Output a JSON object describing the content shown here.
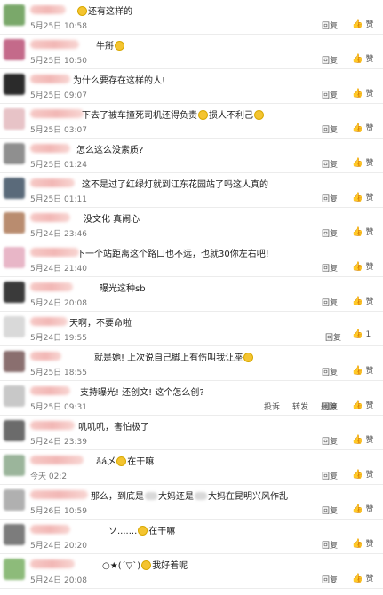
{
  "ui": {
    "reply_label": "回复",
    "like_label": "赞",
    "like_icon": "thumbs-up-icon"
  },
  "comments": [
    {
      "text": "还有这样的",
      "emoji_before": true,
      "time": "5月25日 10:58"
    },
    {
      "text": "牛掰",
      "emoji_after": true,
      "time": "5月25日 10:50"
    },
    {
      "text": "为什么要存在这样的人!",
      "time": "5月25日 09:07"
    },
    {
      "text": "下去了被车撞死司机还得负责",
      "text2": "损人不利己",
      "time": "5月25日 03:07"
    },
    {
      "text": "怎么这么没素质?",
      "time": "5月25日 01:24"
    },
    {
      "text": "这不是过了红绿灯就到江东花园站了吗这人真的",
      "time": "5月25日 01:11"
    },
    {
      "text": "没文化 真闹心",
      "time": "5月24日 23:46"
    },
    {
      "text": "下一个站距离这个路口也不远，也就30你左右吧!",
      "time": "5月24日 21:40"
    },
    {
      "text": "曝光这种sb",
      "time": "5月24日 20:08"
    },
    {
      "text": "天啊，不要命啦",
      "time": "5月24日 19:55",
      "like_count": "1"
    },
    {
      "text": "就是她! 上次说自己脚上有伤叫我让座",
      "time": "5月25日 18:55"
    },
    {
      "text": "支持曝光! 还创文! 这个怎么创?",
      "time": "5月25日 09:31",
      "extra_actions": [
        "投诉",
        "转发",
        "删除"
      ]
    },
    {
      "text": "叽叽叽，害怕极了",
      "time": "5月24日 23:39"
    },
    {
      "text": "在干嘛",
      "prefix": "ǎá乄",
      "time": "今天 02:2"
    },
    {
      "text": "那么，到底是",
      "text2": "大妈还是",
      "text3": "大妈在昆明兴风作乱",
      "time": "5月26日 10:59"
    },
    {
      "text": "在干嘛",
      "prefix": "ソ.......",
      "time": "5月24日 20:20"
    },
    {
      "text": "我好着呢",
      "prefix": "○★(´▽`)",
      "time": "5月24日 20:08"
    }
  ]
}
